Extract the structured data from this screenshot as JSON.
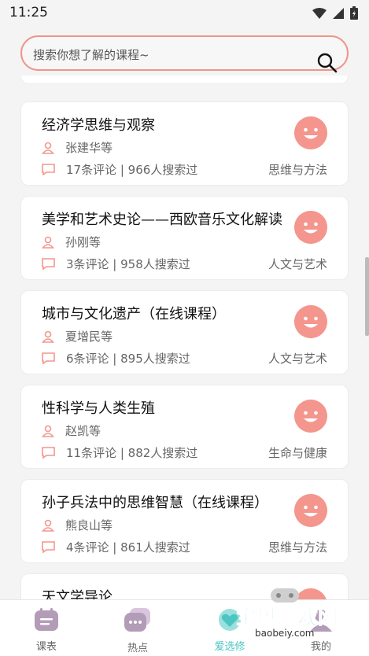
{
  "status_bar": {
    "time": "11:25"
  },
  "search": {
    "placeholder": "搜索你想了解的课程~"
  },
  "courses": [
    {
      "title": "经济学思维与观察",
      "teacher": "张建华等",
      "stats": "17条评论 | 966人搜索过",
      "category": "思维与方法"
    },
    {
      "title": "美学和艺术史论——西欧音乐文化解读",
      "teacher": "孙刚等",
      "stats": "3条评论 | 958人搜索过",
      "category": "人文与艺术"
    },
    {
      "title": "城市与文化遗产（在线课程）",
      "teacher": "夏增民等",
      "stats": "6条评论 | 895人搜索过",
      "category": "人文与艺术"
    },
    {
      "title": "性科学与人类生殖",
      "teacher": "赵凯等",
      "stats": "11条评论 | 882人搜索过",
      "category": "生命与健康"
    },
    {
      "title": "孙子兵法中的思维智慧（在线课程）",
      "teacher": "熊良山等",
      "stats": "4条评论 | 861人搜索过",
      "category": "思维与方法"
    },
    {
      "title": "天文学导论",
      "teacher": "",
      "stats": "",
      "category": ""
    }
  ],
  "nav": {
    "items": [
      {
        "label": "课表"
      },
      {
        "label": "热点"
      },
      {
        "label": "爱选修"
      },
      {
        "label": "我的"
      }
    ]
  },
  "watermark": {
    "text": "宝贝游戏网",
    "url": "baobeiy.com"
  },
  "colors": {
    "accent": "#f4968d",
    "active_tab": "#4bc6c2",
    "search_border": "#f0948a"
  }
}
